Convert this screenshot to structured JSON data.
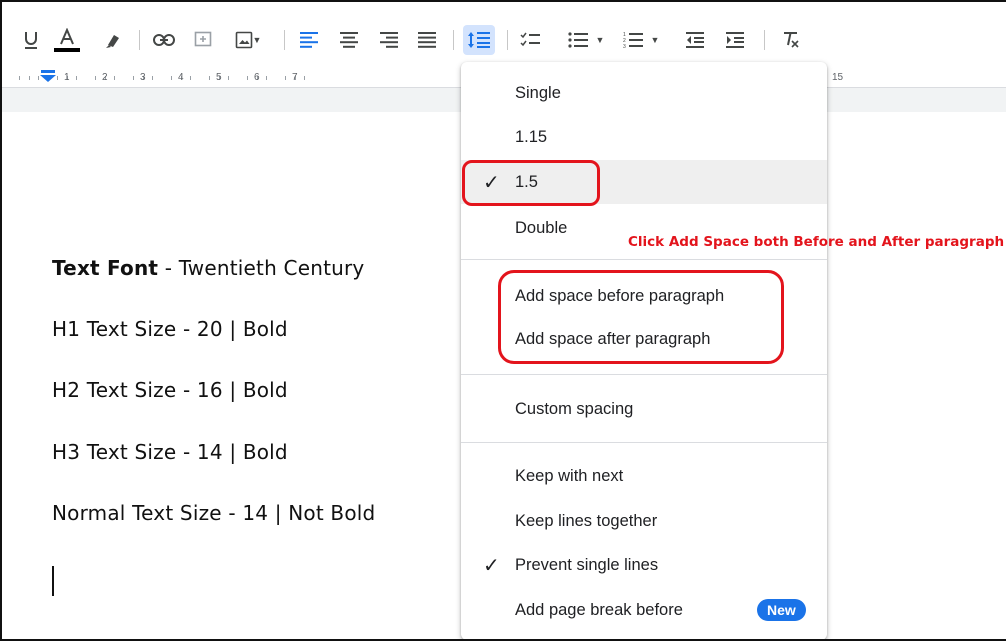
{
  "ruler": {
    "numbers": [
      "1",
      "2",
      "3",
      "4",
      "5",
      "6",
      "7",
      "15"
    ]
  },
  "document": {
    "lines": [
      {
        "bold": "Text Font",
        "rest": " - Twentieth Century"
      },
      {
        "bold": "",
        "rest": "H1 Text Size - 20 | Bold"
      },
      {
        "bold": "",
        "rest": "H2 Text Size - 16 | Bold"
      },
      {
        "bold": "",
        "rest": "H3 Text Size - 14 | Bold"
      },
      {
        "bold": "",
        "rest": "Normal Text Size - 14 | Not Bold"
      }
    ]
  },
  "menu": {
    "items": [
      {
        "label": "Single",
        "checked": false
      },
      {
        "label": "1.15",
        "checked": false
      },
      {
        "label": "1.5",
        "checked": true
      },
      {
        "label": "Double",
        "checked": false
      },
      {
        "label": "Add space before paragraph",
        "checked": false
      },
      {
        "label": "Add space after paragraph",
        "checked": false
      },
      {
        "label": "Custom spacing",
        "checked": false
      },
      {
        "label": "Keep with next",
        "checked": false
      },
      {
        "label": "Keep lines together",
        "checked": false
      },
      {
        "label": "Prevent single lines",
        "checked": true
      },
      {
        "label": "Add page break before",
        "checked": false
      }
    ],
    "check_glyph": "✓",
    "new_badge": "New"
  },
  "annotation": {
    "text": "Click Add Space both Before and After paragraph",
    "color": "#e3141c"
  },
  "colors": {
    "accent": "#1a73e8",
    "active_button_bg": "#d3e3fd",
    "selected_item_bg": "#efefef"
  },
  "icons": {
    "toolbar": [
      "underline-icon",
      "text-color-icon",
      "highlight-icon",
      "link-icon",
      "comment-icon",
      "image-icon",
      "align-left-icon",
      "align-center-icon",
      "align-right-icon",
      "justify-icon",
      "line-spacing-icon",
      "checklist-icon",
      "bulleted-list-icon",
      "numbered-list-icon",
      "decrease-indent-icon",
      "increase-indent-icon",
      "clear-formatting-icon"
    ]
  }
}
